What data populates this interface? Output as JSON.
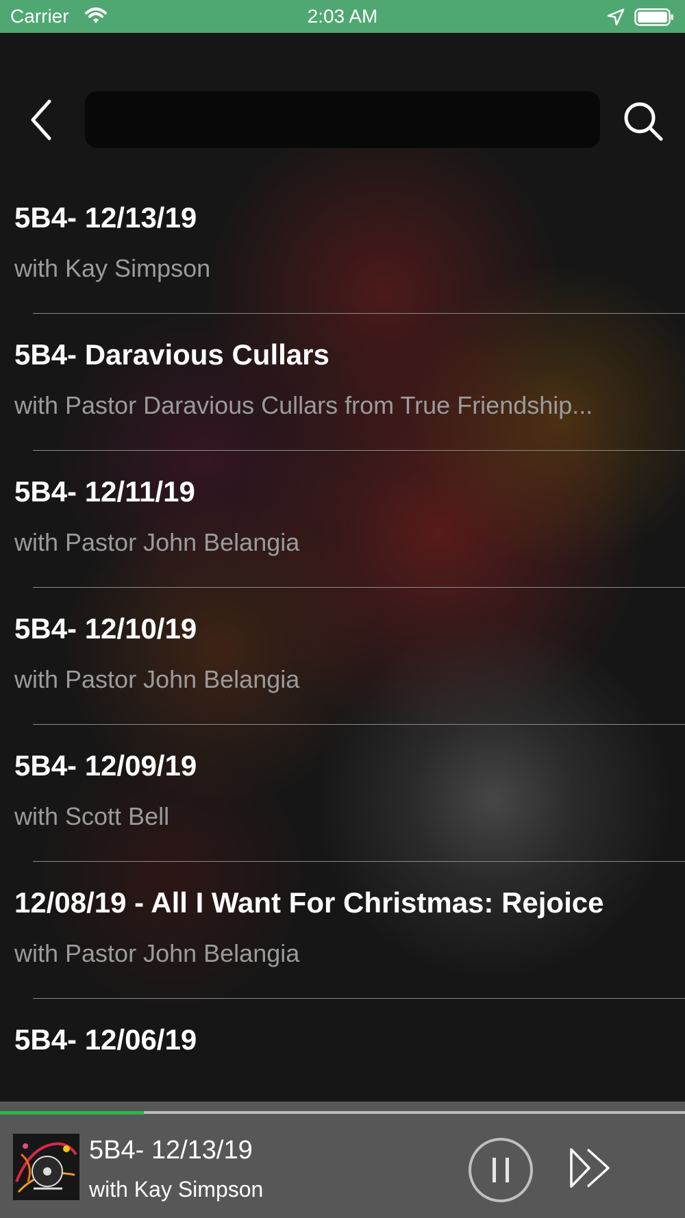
{
  "status_bar": {
    "carrier": "Carrier",
    "time": "2:03 AM"
  },
  "search": {
    "value": "",
    "placeholder": ""
  },
  "episodes": [
    {
      "title": "5B4- 12/13/19",
      "subtitle": "with Kay Simpson"
    },
    {
      "title": "5B4- Daravious Cullars",
      "subtitle": "with Pastor Daravious Cullars from True Friendship..."
    },
    {
      "title": "5B4- 12/11/19",
      "subtitle": "with Pastor John Belangia"
    },
    {
      "title": "5B4- 12/10/19",
      "subtitle": "with Pastor John Belangia"
    },
    {
      "title": "5B4- 12/09/19",
      "subtitle": "with Scott Bell"
    },
    {
      "title": "12/08/19 - All I Want For Christmas: Rejoice",
      "subtitle": "with Pastor John Belangia"
    },
    {
      "title": "5B4- 12/06/19",
      "subtitle": ""
    }
  ],
  "player": {
    "title": "5B4- 12/13/19",
    "subtitle": "with Kay Simpson",
    "progress": 0.21,
    "state": "playing"
  },
  "icons": {
    "back": "chevron-left-icon",
    "search": "magnifier-icon",
    "pause": "pause-icon",
    "fast_forward": "fast-forward-icon"
  },
  "colors": {
    "status_bar": "#4fa871",
    "progress_fill": "#2fb54a",
    "player_bg": "#575757",
    "subtitle_gray": "#9b9b9b"
  }
}
